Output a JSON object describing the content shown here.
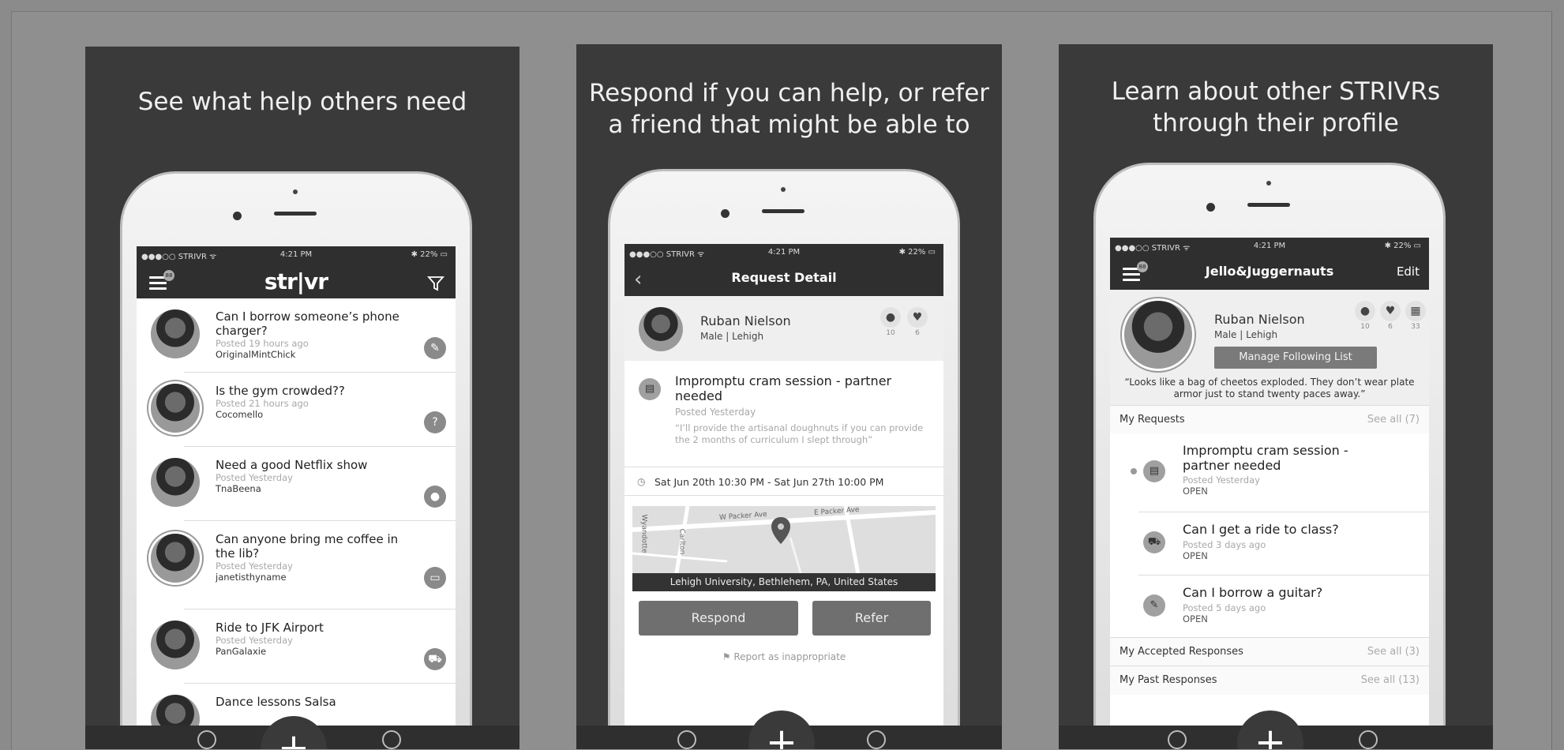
{
  "panels": [
    {
      "title_lines": [
        "See what help others need"
      ]
    },
    {
      "title_lines": [
        "Respond if you can help, or refer",
        "a friend that might be able to"
      ]
    },
    {
      "title_lines": [
        "Learn about other STRIVRs",
        "through their profile"
      ]
    }
  ],
  "status": {
    "carrier": "●●●○○ STRIVR ᯤ",
    "time": "4:21 PM",
    "battery": "✱ 22% ▭"
  },
  "feed": {
    "logo": "str|vr",
    "badge": "88",
    "items": [
      {
        "title": "Can I borrow someone’s phone charger?",
        "posted": "Posted 19 hours ago",
        "user": "OriginalMintChick",
        "cat_icon": "pen-icon",
        "cat_glyph": "✎"
      },
      {
        "title": "Is the gym crowded??",
        "posted": "Posted 21 hours ago",
        "user": "Cocomello",
        "cat_icon": "question-icon",
        "cat_glyph": "?"
      },
      {
        "title": "Need a good Netflix show",
        "posted": "Posted Yesterday",
        "user": "TnaBeena",
        "cat_icon": "film-icon",
        "cat_glyph": "●"
      },
      {
        "title": "Can anyone bring me coffee in the lib?",
        "posted": "Posted Yesterday",
        "user": "janetisthyname",
        "cat_icon": "laptop-icon",
        "cat_glyph": "▭"
      },
      {
        "title": "Ride to JFK Airport",
        "posted": "Posted Yesterday",
        "user": "PanGalaxie",
        "cat_icon": "car-icon",
        "cat_glyph": "⛟"
      },
      {
        "title": "Dance lessons Salsa",
        "posted": "",
        "user": "",
        "cat_icon": "",
        "cat_glyph": ""
      }
    ]
  },
  "detail": {
    "nav_title": "Request Detail",
    "user_name": "Ruban Nielson",
    "user_sub": "Male | Lehigh",
    "stats": [
      {
        "glyph": "●",
        "value": "10"
      },
      {
        "glyph": "♥",
        "value": "6"
      }
    ],
    "req_title": "Impromptu cram session - partner needed",
    "req_posted": "Posted Yesterday",
    "req_quote": "“I’ll provide the artisanal doughnuts if you can provide the 2 months of curriculum I slept through”",
    "time_range": "Sat Jun 20th 10:30 PM - Sat Jun 27th 10:00 PM",
    "map_streets": [
      "W Packer Ave",
      "E Packer Ave",
      "Carlton",
      "Wyandotte"
    ],
    "location": "Lehigh University, Bethlehem, PA, United States",
    "respond_label": "Respond",
    "refer_label": "Refer",
    "report_label": "Report as inappropriate"
  },
  "profile": {
    "nav_title": "Jello&Juggernauts",
    "edit_label": "Edit",
    "badge": "88",
    "user_name": "Ruban Nielson",
    "user_sub": "Male | Lehigh",
    "stats": [
      {
        "glyph": "●",
        "value": "10"
      },
      {
        "glyph": "♥",
        "value": "6"
      },
      {
        "glyph": "▦",
        "value": "33"
      }
    ],
    "manage_label": "Manage Following List",
    "bio": "“Looks like a bag of cheetos exploded. They don’t wear plate armor just to stand twenty paces away.”",
    "my_requests": "My Requests",
    "my_requests_see": "See all (7)",
    "requests": [
      {
        "title": "Impromptu cram session - partner needed",
        "posted": "Posted Yesterday",
        "status": "OPEN",
        "glyph": "▤"
      },
      {
        "title": "Can I get a ride to class?",
        "posted": "Posted 3 days ago",
        "status": "OPEN",
        "glyph": "⛟"
      },
      {
        "title": "Can I borrow a guitar?",
        "posted": "Posted 5 days ago",
        "status": "OPEN",
        "glyph": "✎"
      }
    ],
    "accepted": "My Accepted Responses",
    "accepted_see": "See all (3)",
    "past": "My Past Responses",
    "past_see": "See all (13)"
  },
  "fab_glyph": "+"
}
